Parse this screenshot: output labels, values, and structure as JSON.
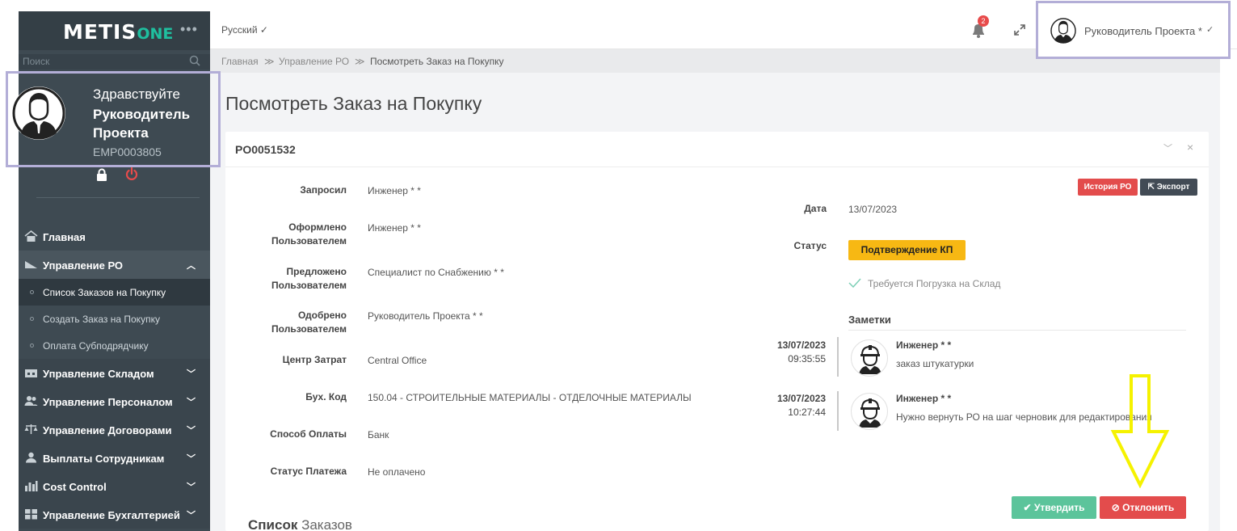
{
  "app": {
    "logo_main": "METIS",
    "logo_suffix": "ONE",
    "menu_dots": "•••"
  },
  "search": {
    "placeholder": "Поиск"
  },
  "profile": {
    "greeting": "Здравствуйте",
    "name": "Руководитель Проекта",
    "emp_id": "EMP0003805"
  },
  "nav": {
    "home": "Главная",
    "po_mgmt": "Управление РО",
    "po_list": "Список Заказов на Покупку",
    "po_create": "Создать Заказ на Покупку",
    "subcontractor_pay": "Оплата Субподрядчику",
    "warehouse": "Управление Складом",
    "personnel": "Управление Персоналом",
    "contracts": "Управление Договорами",
    "employee_pay": "Выплаты Сотрудникам",
    "cost_control": "Cost Control",
    "accounting": "Управление Бухгалтерией"
  },
  "header": {
    "language": "Русский",
    "notif_count": "2",
    "user": "Руководитель Проекта *"
  },
  "breadcrumb": {
    "home": "Главная",
    "sep": "≫",
    "po_mgmt": "Управление РО",
    "current": "Посмотреть Заказ на Покупку"
  },
  "page": {
    "title": "Посмотреть Заказ на Покупку"
  },
  "po": {
    "id": "PO0051532",
    "fields": {
      "requested_label": "Запросил",
      "requested_value": "Инженер * *",
      "created_label": "Оформлено Пользователем",
      "created_value": "Инженер * *",
      "proposed_label": "Предложено Пользователем",
      "proposed_value": "Специалист по Снабжению * *",
      "approved_label": "Одобрено Пользователем",
      "approved_value": "Руководитель Проекта * *",
      "cost_center_label": "Центр Затрат",
      "cost_center_value": "Central Office",
      "acc_code_label": "Бух. Код",
      "acc_code_value": "150.04 - СТРОИТЕЛЬНЫЕ МАТЕРИАЛЫ - ОТДЕЛОЧНЫЕ МАТЕРИАЛЫ",
      "pay_method_label": "Способ Оплаты",
      "pay_method_value": "Банк",
      "pay_status_label": "Статус Платежа",
      "pay_status_value": "Не оплачено",
      "date_label": "Дата",
      "date_value": "13/07/2023",
      "status_label": "Статус",
      "status_value": "Подтверждение КП"
    },
    "history_btn": "История РО",
    "export_btn": "Экспорт",
    "warehouse_check": "Требуется Погрузка на Склад",
    "notes_title": "Заметки",
    "notes": [
      {
        "date": "13/07/2023",
        "time": "09:35:55",
        "author": "Инженер * *",
        "text": "заказ штукатурки"
      },
      {
        "date": "13/07/2023",
        "time": "10:27:44",
        "author": "Инженер * *",
        "text": "Нужно вернуть РО на шаг черновик для редактирования"
      }
    ],
    "approve_btn": "Утвердить",
    "reject_btn": "Отклонить",
    "orders_title_bold": "Список",
    "orders_title_rest": "Заказов"
  },
  "colors": {
    "sidebar": "#3e4a52",
    "accent": "#1fbf9f",
    "approve": "#5cc49b",
    "reject": "#e34c4c",
    "status": "#f7b813",
    "highlight": "#b3aed7",
    "annotation": "#f5f200"
  }
}
